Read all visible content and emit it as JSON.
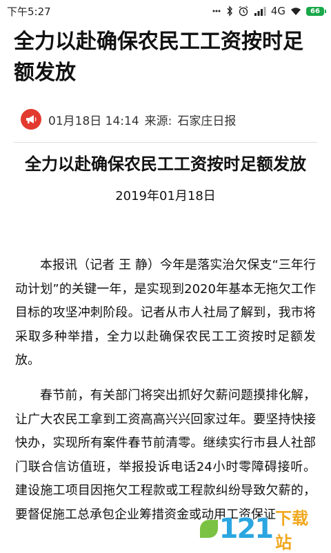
{
  "status_bar": {
    "time": "下午5:27",
    "network": "4G",
    "battery": "66"
  },
  "article": {
    "title": "全力以赴确保农民工工资按时足额发放",
    "date_time": "01月18日 14:14",
    "source_label": "来源:",
    "source": "石家庄日报"
  },
  "body": {
    "title": "全力以赴确保农民工工资按时足额发放",
    "date": "2019年01月18日",
    "paragraphs": [
      "本报讯（记者 王 静）今年是落实治欠保支“三年行动计划”的关键一年，是实现到2020年基本无拖欠工作目标的攻坚冲刺阶段。记者从市人社局了解到，我市将采取多种举措，全力以赴确保农民工工资按时足额发放。",
      "春节前，有关部门将突出抓好欠薪问题摸排化解，让广大农民工拿到工资高高兴兴回家过年。要坚持快接快办，实现所有案件春节前清零。继续实行市县人社部门联合信访值班，举报投诉电话24小时零障碍接听。建设施工项目因拖欠工程款或工程款纠纷导致欠薪的，要督促施工总承包企业筹措资金或动用工资保证"
    ]
  },
  "watermark": {
    "number": "121",
    "text": "下载站"
  },
  "colors": {
    "logo_red": "#e23a2e",
    "battery_green": "#19a84a"
  }
}
